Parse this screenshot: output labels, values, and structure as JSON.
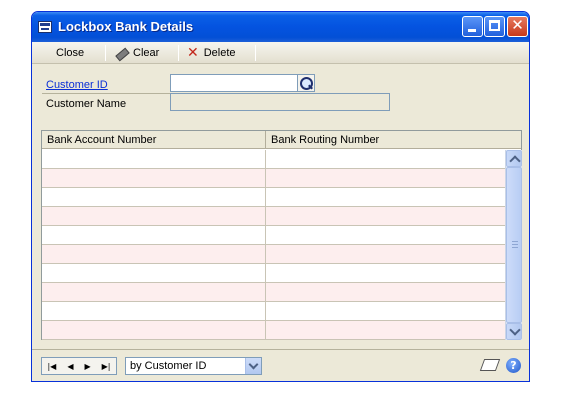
{
  "window": {
    "title": "Lockbox Bank Details",
    "icons": {
      "app": "window-app-icon",
      "minimize": "minimize-icon",
      "maximize": "maximize-icon",
      "close": "close-icon"
    },
    "close_glyph": "✕"
  },
  "toolbar": {
    "close_label": "Close",
    "clear_label": "Clear",
    "delete_label": "Delete",
    "delete_glyph": "✕"
  },
  "form": {
    "customer_id_label": "Customer ID",
    "customer_id_value": "",
    "customer_name_label": "Customer Name",
    "customer_name_value": ""
  },
  "grid": {
    "columns": [
      "Bank Account Number",
      "Bank Routing Number"
    ],
    "rows": [
      [
        "",
        ""
      ],
      [
        "",
        ""
      ],
      [
        "",
        ""
      ],
      [
        "",
        ""
      ],
      [
        "",
        ""
      ],
      [
        "",
        ""
      ],
      [
        "",
        ""
      ],
      [
        "",
        ""
      ],
      [
        "",
        ""
      ],
      [
        "",
        ""
      ]
    ]
  },
  "navigation": {
    "first": "|◀",
    "prev": "◀",
    "next": "▶",
    "last": "▶|",
    "sort_value": "by Customer ID"
  },
  "help": {
    "glyph": "?"
  },
  "colors": {
    "title_bar": "#0453e0",
    "window_bg": "#ece9d8",
    "link": "#0a2fd6",
    "grid_alt_row": "#fdeeee"
  }
}
